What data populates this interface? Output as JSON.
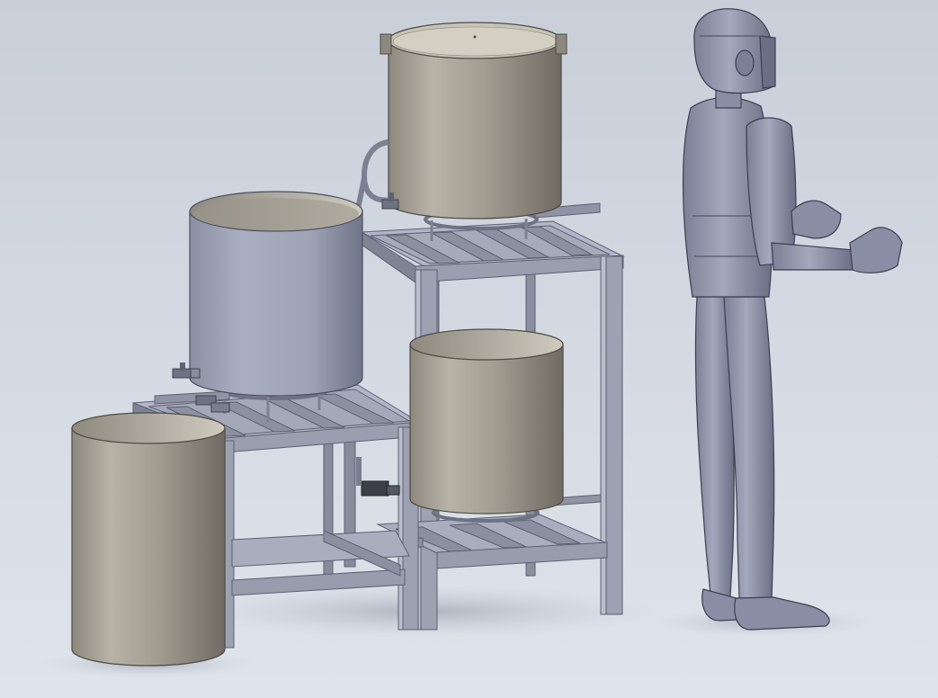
{
  "colors": {
    "background_top": "#c9cfd9",
    "background_bottom": "#dfe4ec",
    "frame": "#8f93a4",
    "frame_dark": "#6b6f80",
    "frame_light": "#b4b8c8",
    "pot_bronze": "#a39e92",
    "pot_bronze_dark": "#7c786f",
    "pot_bronze_light": "#c7c2b6",
    "pot_steel": "#9ea3b5",
    "pot_steel_dark": "#767b8e",
    "pot_steel_light": "#c0c4d3",
    "figure_body": "#8e92a8",
    "figure_dark": "#5e6278",
    "figure_light": "#b6b9cb",
    "shadow": "#b9bec8"
  },
  "icons": {
    "valve": "valve-icon",
    "burner": "burner-ring-icon"
  }
}
